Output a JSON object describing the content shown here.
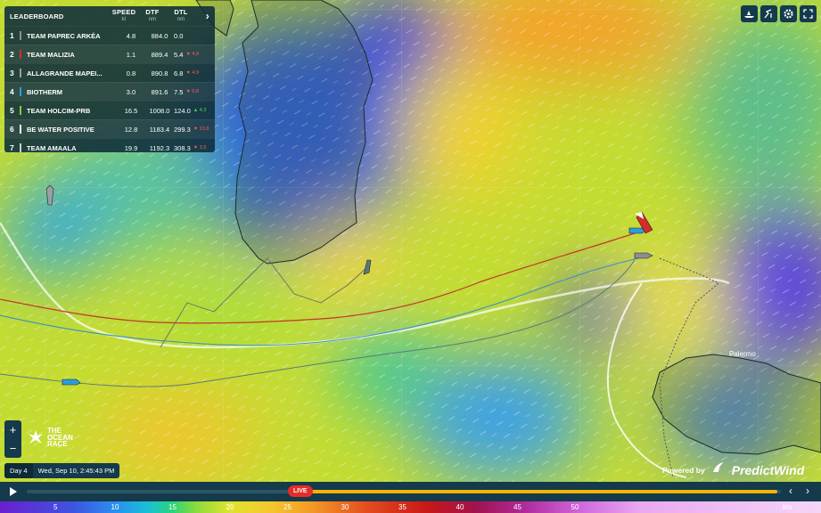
{
  "leaderboard": {
    "title": "LEADERBOARD",
    "columns": [
      {
        "label": "SPEED",
        "unit": "kt"
      },
      {
        "label": "DTF",
        "unit": "nm"
      },
      {
        "label": "DTL",
        "unit": "nm"
      }
    ],
    "rows": [
      {
        "rank": "1",
        "name": "TEAM PAPREC ARKÉA",
        "speed": "4.8",
        "dtf": "884.0",
        "dtl": "0.0",
        "change": "",
        "dir": "",
        "color": "#8b8f95"
      },
      {
        "rank": "2",
        "name": "TEAM MALIZIA",
        "speed": "1.1",
        "dtf": "889.4",
        "dtl": "5.4",
        "change": "4.9",
        "dir": "down",
        "color": "#d62b2b"
      },
      {
        "rank": "3",
        "name": "ALLAGRANDE MAPEI...",
        "speed": "0.8",
        "dtf": "890.8",
        "dtl": "6.8",
        "change": "4.9",
        "dir": "down",
        "color": "#9aa0a6"
      },
      {
        "rank": "4",
        "name": "BIOTHERM",
        "speed": "3.0",
        "dtf": "891.6",
        "dtl": "7.5",
        "change": "5.8",
        "dir": "down",
        "color": "#2a9de0"
      },
      {
        "rank": "5",
        "name": "TEAM HOLCIM-PRB",
        "speed": "16.5",
        "dtf": "1008.0",
        "dtl": "124.0",
        "change": "4.3",
        "dir": "up",
        "color": "#8cc63f"
      },
      {
        "rank": "6",
        "name": "BE WATER POSITIVE",
        "speed": "12.8",
        "dtf": "1183.4",
        "dtl": "299.3",
        "change": "13.8",
        "dir": "down",
        "color": "#ffffff"
      },
      {
        "rank": "7",
        "name": "TEAM AMAALA",
        "speed": "19.9",
        "dtf": "1192.3",
        "dtl": "308.3",
        "change": "3.5",
        "dir": "down",
        "color": "#c8d0d4"
      }
    ]
  },
  "toolbar": {
    "icons": [
      "boat-icon",
      "route-icon",
      "settings-icon",
      "fullscreen-icon"
    ]
  },
  "map": {
    "place_label": "Palermo"
  },
  "zoom": {
    "in": "+",
    "out": "−"
  },
  "brand": {
    "line1": "THE",
    "line2": "OCEAN",
    "line3": "RACE"
  },
  "time": {
    "day": "Day 4",
    "datetime": "Wed, Sep 10, 2:45:43 PM"
  },
  "powered": {
    "label": "Powered by",
    "brand": "PredictWind"
  },
  "timeline": {
    "live_label": "LIVE",
    "progress": 0.995,
    "live_position": 0.36
  },
  "wind_scale": {
    "ticks": [
      "5",
      "10",
      "15",
      "20",
      "25",
      "30",
      "35",
      "40",
      "45",
      "50"
    ],
    "unit": "kts"
  },
  "colors": {
    "panel": "#0e2c3a",
    "accent": "#f4b400",
    "live": "#e52d27"
  }
}
